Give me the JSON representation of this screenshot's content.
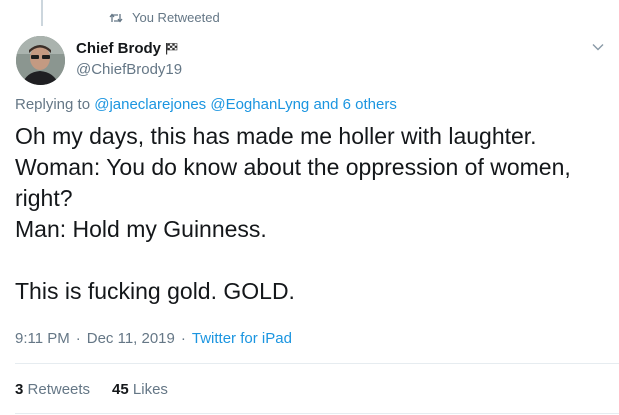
{
  "retweet_context": {
    "label": "You Retweeted",
    "icon": "retweet-icon"
  },
  "author": {
    "name": "Chief Brody",
    "handle": "@ChiefBrody19",
    "badge_icon": "checkered-flag-icon",
    "avatar_icon": "avatar-photo"
  },
  "menu": {
    "icon": "chevron-down-icon"
  },
  "replying": {
    "prefix": "Replying to",
    "mention_1": "@janeclarejones",
    "mention_2": "@EoghanLyng",
    "and_others": "and 6 others"
  },
  "tweet": {
    "lines": [
      "Oh my days, this has made me holler with laughter.",
      "Woman: You do know about the oppression of women,",
      "right?",
      "Man: Hold my Guinness.",
      "",
      "This is fucking gold. GOLD."
    ]
  },
  "meta": {
    "time": "9:11 PM",
    "date": "Dec 11, 2019",
    "separator": "·",
    "source": "Twitter for iPad"
  },
  "stats": {
    "retweets_count": "3",
    "retweets_label": "Retweets",
    "likes_count": "45",
    "likes_label": "Likes"
  },
  "colors": {
    "text": "#14171a",
    "secondary": "#657786",
    "link": "#1b95e0",
    "divider": "#e6ecf0"
  }
}
